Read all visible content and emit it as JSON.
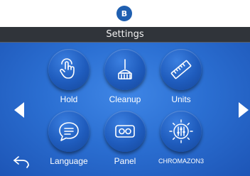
{
  "badge": {
    "text": "B"
  },
  "header": {
    "title": "Settings"
  },
  "nav": {
    "left_icon": "arrow-left-icon",
    "right_icon": "arrow-right-icon",
    "back_icon": "back-arrow-icon"
  },
  "tiles": [
    {
      "label": "Hold",
      "icon": "touch-hand-icon"
    },
    {
      "label": "Cleanup",
      "icon": "broom-icon"
    },
    {
      "label": "Units",
      "icon": "ruler-icon"
    },
    {
      "label": "Language",
      "icon": "chat-bubble-icon"
    },
    {
      "label": "Panel",
      "icon": "panel-icon"
    },
    {
      "label": "CHROMAZON3",
      "icon": "chromazon-sliders-icon"
    }
  ],
  "colors": {
    "badge": "#1f5fb0",
    "titlebar": "#30343a",
    "screen": "#2b6fd2",
    "button": "#1f5cbd"
  }
}
